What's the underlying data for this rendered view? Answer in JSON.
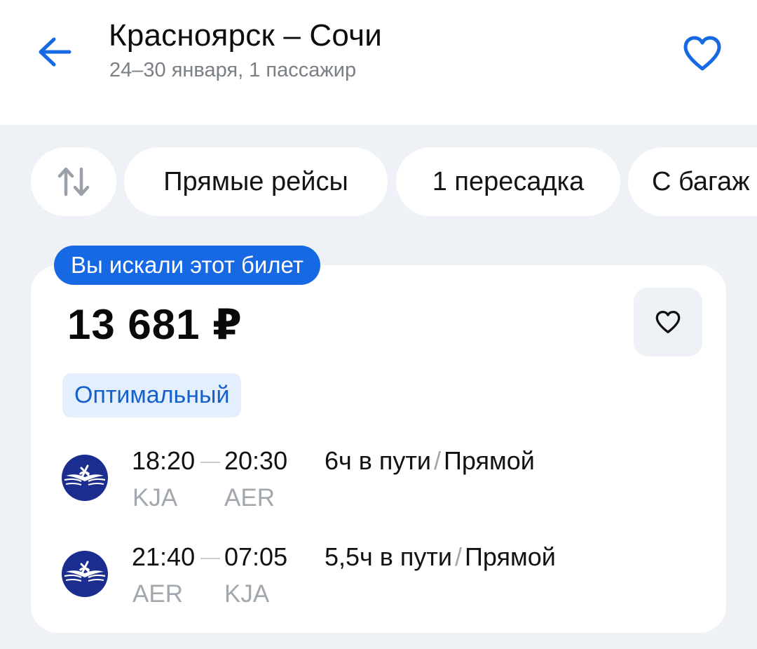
{
  "header": {
    "title": "Красноярск – Сочи",
    "subtitle": "24–30 января, 1 пассажир"
  },
  "filters": {
    "sort_icon": "sort-arrows-icon",
    "chips": [
      {
        "label": "Прямые рейсы"
      },
      {
        "label": "1 пересадка"
      },
      {
        "label": "С багаж"
      }
    ]
  },
  "ticket": {
    "badge": "Вы искали этот билет",
    "price": "13 681 ₽",
    "tag": "Оптимальный",
    "segments": [
      {
        "dep_time": "18:20",
        "arr_time": "20:30",
        "dep_code": "KJA",
        "arr_code": "AER",
        "duration": "6ч в пути",
        "type": "Прямой"
      },
      {
        "dep_time": "21:40",
        "arr_time": "07:05",
        "dep_code": "AER",
        "arr_code": "KJA",
        "duration": "5,5ч в пути",
        "type": "Прямой"
      }
    ]
  },
  "colors": {
    "accent": "#1668e3",
    "background": "#eef1f5",
    "card": "#ffffff",
    "tag_bg": "#e3effd",
    "airline_logo": "#1b2d8f"
  }
}
